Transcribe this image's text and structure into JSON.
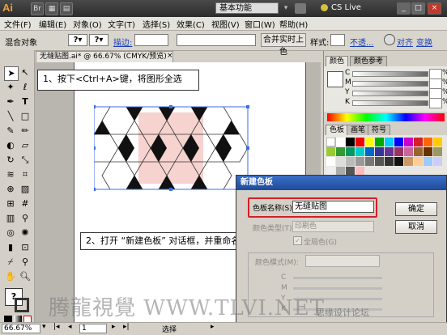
{
  "titlebar": {
    "logo": "Ai",
    "workspace": "基本功能",
    "cs_live": "CS Live"
  },
  "menus": [
    "文件(F)",
    "编辑(E)",
    "对象(O)",
    "文字(T)",
    "选择(S)",
    "效果(C)",
    "视图(V)",
    "窗口(W)",
    "帮助(H)"
  ],
  "controlbar": {
    "object_label": "混合对象",
    "stroke_label": "描边:",
    "merge_button": "合并实时上色",
    "style_label": "样式:",
    "opacity_link": "不透...",
    "align_link": "对齐",
    "transform_link": "变换"
  },
  "document": {
    "tab_title": "无缝贴图.ai* @ 66.67% (CMYK/预览)"
  },
  "panels": {
    "top_tabs": [
      "颜色",
      "颜色参考"
    ],
    "channels": [
      {
        "label": "C",
        "pct": "%"
      },
      {
        "label": "M",
        "pct": "%"
      },
      {
        "label": "Y",
        "pct": "%"
      },
      {
        "label": "K",
        "pct": "%"
      }
    ],
    "swatch_tabs": [
      "色板",
      "画笔",
      "符号"
    ]
  },
  "callouts": {
    "step1": "1、按下<Ctrl+A>键，将图形全选",
    "step2": "2、打开 “新建色板” 对话框，并重命名"
  },
  "dialog": {
    "title": "新建色板",
    "name_label": "色板名称(S):",
    "name_value": "无缝贴图",
    "ok": "确定",
    "cancel": "取消",
    "type_label": "颜色类型(T):",
    "type_value": "印刷色",
    "global_label": "全局色(G)",
    "mode_label": "颜色模式(M):",
    "channels": [
      "C",
      "M",
      "Y",
      "K"
    ]
  },
  "status": {
    "zoom": "66.67%",
    "page": "1",
    "tool": "选择"
  },
  "watermark": "腾龍視覺 WWW.TLVI.NET",
  "watermark2": "思缘设计论坛",
  "colors": {
    "accent_red": "#d42027",
    "selection": "#3a6ee8",
    "pink": "#f6d3cf"
  }
}
